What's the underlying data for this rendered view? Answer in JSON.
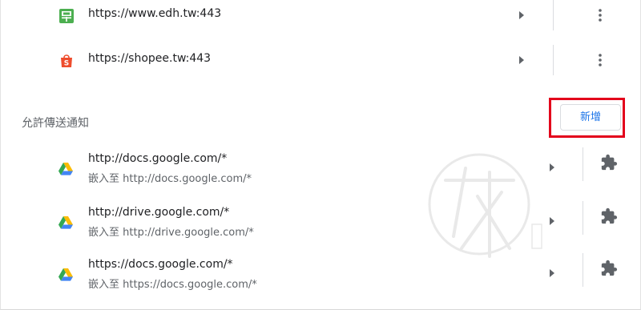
{
  "sites": [
    {
      "url": "https://www.edh.tw:443",
      "favicon": "edh-favicon-icon"
    },
    {
      "url": "https://shopee.tw:443",
      "favicon": "shopee-bag-icon"
    }
  ],
  "notifications_section": {
    "title": "允許傳送通知",
    "add_button_label": "新增"
  },
  "extensions": [
    {
      "url": "http://docs.google.com/*",
      "embedded": "嵌入至 http://docs.google.com/*",
      "favicon": "google-drive-icon"
    },
    {
      "url": "http://drive.google.com/*",
      "embedded": "嵌入至 http://drive.google.com/*",
      "favicon": "google-drive-icon"
    },
    {
      "url": "https://docs.google.com/*",
      "embedded": "嵌入至 https://docs.google.com/*",
      "favicon": "google-drive-icon"
    }
  ],
  "colors": {
    "accent": "#1a73e8",
    "highlight": "#e3001b",
    "edh_green": "#4caf50",
    "shopee_orange": "#ee4d2d"
  }
}
